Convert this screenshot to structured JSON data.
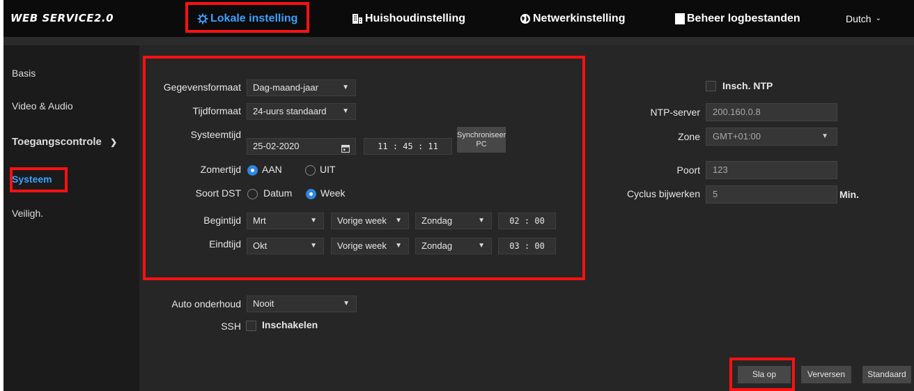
{
  "brand": "WEB SERVICE2.0",
  "nav": {
    "local": "Lokale instelling",
    "household": "Huishoudinstelling",
    "network": "Netwerkinstelling",
    "logs": "Beheer logbestanden"
  },
  "language": "Dutch",
  "sidebar": {
    "basis": "Basis",
    "video_audio": "Video & Audio",
    "access_control": "Toegangscontrole",
    "system": "Systeem",
    "security": "Veiligh."
  },
  "form": {
    "date_format_label": "Gegevensformaat",
    "date_format_value": "Dag-maand-jaar",
    "time_format_label": "Tijdformaat",
    "time_format_value": "24-uurs standaard",
    "system_time_label": "Systeemtijd",
    "date_value": "25-02-2020",
    "time_h": "11",
    "time_m": "45",
    "time_s": "11",
    "sync_line1": "Synchroniseer",
    "sync_line2": "PC",
    "dst_label": "Zomertijd",
    "dst_on": "AAN",
    "dst_off": "UIT",
    "dst_type_label": "Soort DST",
    "dst_type_date": "Datum",
    "dst_type_week": "Week",
    "start_label": "Begintijd",
    "start_month": "Mrt",
    "start_week": "Vorige week",
    "start_day": "Zondag",
    "start_h": "02",
    "start_m": "00",
    "end_label": "Eindtijd",
    "end_month": "Okt",
    "end_week": "Vorige week",
    "end_day": "Zondag",
    "end_h": "03",
    "end_m": "00",
    "auto_maint_label": "Auto onderhoud",
    "auto_maint_value": "Nooit",
    "ssh_label": "SSH",
    "ssh_enable": "Inschakelen"
  },
  "ntp": {
    "enable_label": "Insch. NTP",
    "server_label": "NTP-server",
    "server_value": "200.160.0.8",
    "zone_label": "Zone",
    "zone_value": "GMT+01:00",
    "port_label": "Poort",
    "port_value": "123",
    "cycle_label": "Cyclus bijwerken",
    "cycle_value": "5",
    "cycle_unit": "Min."
  },
  "buttons": {
    "save": "Sla op",
    "refresh": "Verversen",
    "default": "Standaard"
  },
  "colors": {
    "accent": "#3ea0ff",
    "highlight": "#ff1111",
    "panel": "#262626",
    "sidebar": "#1b1b1b",
    "topbar": "#0b0b0b"
  }
}
